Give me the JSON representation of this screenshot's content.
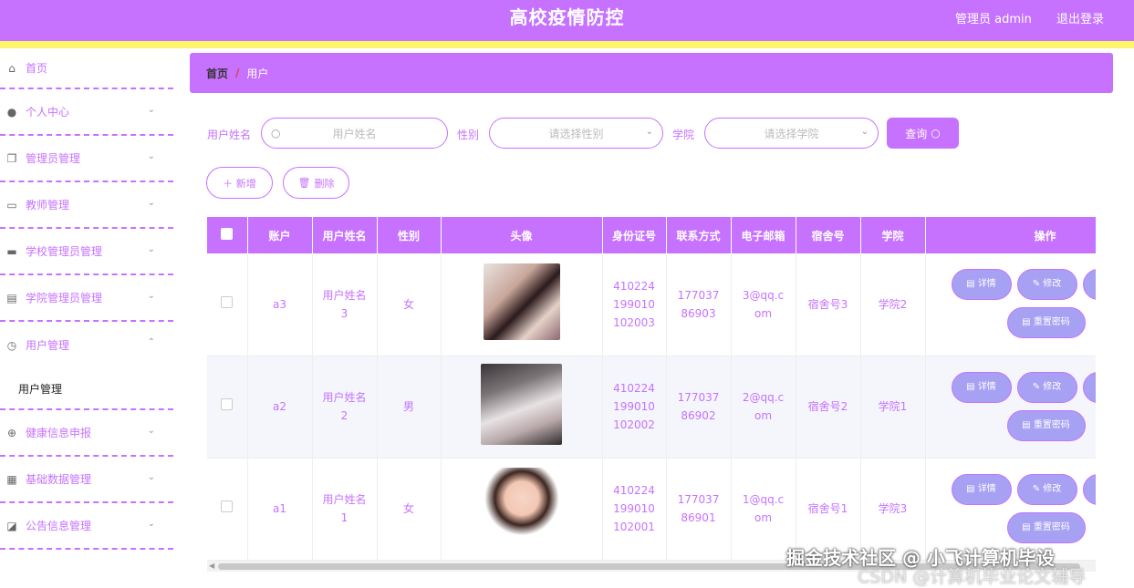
{
  "header": {
    "title": "高校疫情防控",
    "admin": "管理员 admin",
    "logout": "退出登录"
  },
  "sidebar": {
    "items": [
      {
        "label": "首页",
        "icon": "home-icon"
      },
      {
        "label": "个人中心",
        "icon": "user-icon"
      },
      {
        "label": "管理员管理",
        "icon": "copy-icon"
      },
      {
        "label": "教师管理",
        "icon": "card-icon"
      },
      {
        "label": "学校管理员管理",
        "icon": "monitor-icon"
      },
      {
        "label": "学院管理员管理",
        "icon": "clipboard-icon"
      },
      {
        "label": "用户管理",
        "icon": "clock-icon"
      },
      {
        "label": "健康信息申报",
        "icon": "target-icon"
      },
      {
        "label": "基础数据管理",
        "icon": "grid-icon"
      },
      {
        "label": "公告信息管理",
        "icon": "chart-icon"
      }
    ],
    "submenu": "用户管理"
  },
  "breadcrumb": {
    "home": "首页",
    "sep": "/",
    "current": "用户"
  },
  "filters": {
    "name_label": "用户姓名",
    "name_placeholder": "用户姓名",
    "gender_label": "性别",
    "gender_placeholder": "请选择性别",
    "college_label": "学院",
    "college_placeholder": "请选择学院",
    "query_btn": "查询"
  },
  "actions": {
    "add": "＋ 新增",
    "delete": "删除"
  },
  "table": {
    "columns": [
      "账户",
      "用户姓名",
      "性别",
      "头像",
      "身份证号",
      "联系方式",
      "电子邮箱",
      "宿舍号",
      "学院",
      "操作"
    ],
    "rows": [
      {
        "account": "a3",
        "name": "用户姓名3",
        "gender": "女",
        "id": "410224199010102003",
        "phone": "17703786903",
        "email": "3@qq.com",
        "dorm": "宿舍号3",
        "college": "学院2"
      },
      {
        "account": "a2",
        "name": "用户姓名2",
        "gender": "男",
        "id": "410224199010102002",
        "phone": "17703786902",
        "email": "2@qq.com",
        "dorm": "宿舍号2",
        "college": "学院1"
      },
      {
        "account": "a1",
        "name": "用户姓名1",
        "gender": "女",
        "id": "410224199010102001",
        "phone": "17703786901",
        "email": "1@qq.com",
        "dorm": "宿舍号1",
        "college": "学院3"
      }
    ],
    "buttons": {
      "detail": "详情",
      "edit": "修改",
      "reset": "重置密码"
    }
  },
  "watermark": {
    "line1": "掘金技术社区 @ 小飞计算机毕设",
    "line2": "CSDN @计算机毕业论文辅导"
  },
  "colors": {
    "accent": "#c672ff",
    "yellow": "#fff56a",
    "op_button": "#a7a1f4"
  }
}
